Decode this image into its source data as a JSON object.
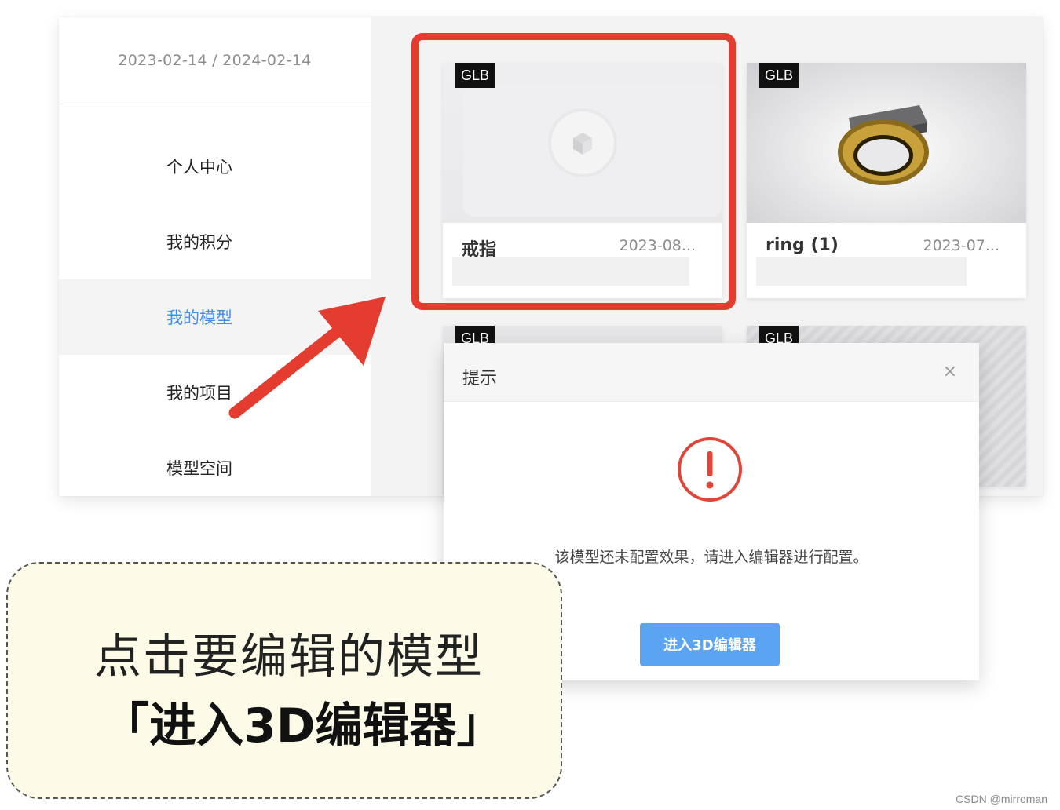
{
  "sidebar": {
    "date_range": "2023-02-14 / 2024-02-14",
    "items": [
      {
        "label": "个人中心"
      },
      {
        "label": "我的积分"
      },
      {
        "label": "我的模型",
        "active": true
      },
      {
        "label": "我的项目"
      },
      {
        "label": "模型空间"
      }
    ]
  },
  "cards": [
    {
      "badge": "GLB",
      "name": "戒指",
      "date": "2023-08..."
    },
    {
      "badge": "GLB",
      "name": "ring (1)",
      "date": "2023-07..."
    },
    {
      "badge": "GLB"
    },
    {
      "badge": "GLB"
    }
  ],
  "dialog": {
    "title": "提示",
    "close_icon": "×",
    "message": "该模型还未配置效果，请进入编辑器进行配置。",
    "button_label": "进入3D编辑器"
  },
  "callout": {
    "line1": "点击要编辑的模型",
    "line2": "「进入3D编辑器」"
  },
  "watermark": "CSDN @mirroman",
  "colors": {
    "accent_blue": "#3f8ef4",
    "button_blue": "#5aa4f3",
    "highlight_red": "#e43d2f",
    "warning_red": "#e0453a"
  }
}
